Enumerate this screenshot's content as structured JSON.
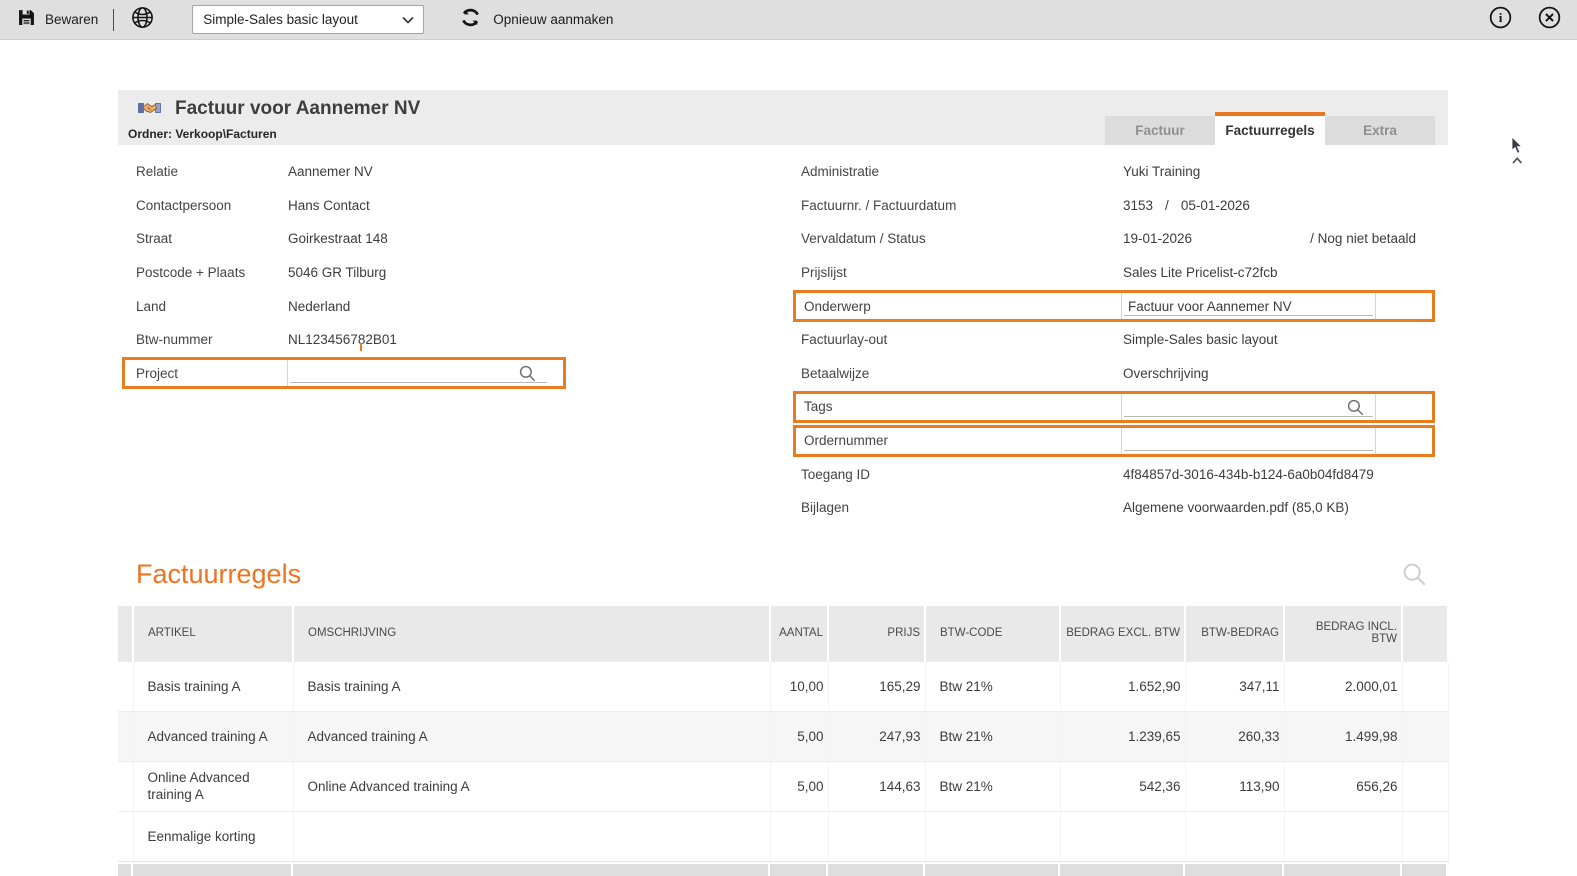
{
  "colors": {
    "accent_orange": "#e87c1e",
    "tab_indicator": "#e87722",
    "section_title": "#ee7420",
    "toolbar_bg": "#dfdfdf"
  },
  "toolbar": {
    "save_label": "Bewaren",
    "layout_select_value": "Simple-Sales basic layout",
    "recreate_label": "Opnieuw aanmaken"
  },
  "header": {
    "title": "Factuur voor Aannemer NV",
    "folder": "Ordner: Verkoop\\Facturen",
    "tabs": [
      {
        "label": "Factuur",
        "active": false
      },
      {
        "label": "Factuurregels",
        "active": true
      },
      {
        "label": "Extra",
        "active": false
      }
    ]
  },
  "details_left": {
    "rows": [
      {
        "label": "Relatie",
        "value": "Aannemer NV"
      },
      {
        "label": "Contactpersoon",
        "value": "Hans Contact"
      },
      {
        "label": "Straat",
        "value": "Goirkestraat 148"
      },
      {
        "label": "Postcode + Plaats",
        "value": "5046 GR Tilburg"
      },
      {
        "label": "Land",
        "value": "Nederland"
      },
      {
        "label": "Btw-nummer",
        "value": "NL123456782B01"
      }
    ],
    "project": {
      "label": "Project",
      "value": ""
    }
  },
  "details_right": {
    "administratie": {
      "label": "Administratie",
      "value": "Yuki Training"
    },
    "factuurnr": {
      "label": "Factuurnr.  /  Factuurdatum",
      "number": "3153",
      "separator": "/",
      "date": "05-01-2026"
    },
    "vervaldatum": {
      "label": "Vervaldatum  /  Status",
      "date": "19-01-2026",
      "status": "/  Nog niet betaald"
    },
    "prijslijst": {
      "label": "Prijslijst",
      "value": "Sales Lite Pricelist-c72fcb"
    },
    "onderwerp": {
      "label": "Onderwerp",
      "value": "Factuur voor Aannemer NV"
    },
    "factuurlayout": {
      "label": "Factuurlay-out",
      "value": "Simple-Sales basic layout"
    },
    "betaalwijze": {
      "label": "Betaalwijze",
      "value": "Overschrijving"
    },
    "tags": {
      "label": "Tags",
      "value": ""
    },
    "ordernummer": {
      "label": "Ordernummer",
      "value": ""
    },
    "toegang_id": {
      "label": "Toegang ID",
      "value": "4f84857d-3016-434b-b124-6a0b04fd8479"
    },
    "bijlagen": {
      "label": "Bijlagen",
      "value": "Algemene voorwaarden.pdf (85,0 KB)"
    }
  },
  "lines": {
    "title": "Factuurregels",
    "table": {
      "headers": [
        "ARTIKEL",
        "OMSCHRIJVING",
        "AANTAL",
        "PRIJS",
        "BTW-CODE",
        "BEDRAG EXCL. BTW",
        "BTW-BEDRAG",
        "BEDRAG INCL. BTW"
      ],
      "rows": [
        {
          "artikel": "Basis training A",
          "omschrijving": "Basis training A",
          "aantal": "10,00",
          "prijs": "165,29",
          "btw_code": "Btw 21%",
          "bedrag_excl": "1.652,90",
          "btw_bedrag": "347,11",
          "bedrag_incl": "2.000,01"
        },
        {
          "artikel": "Advanced training A",
          "omschrijving": "Advanced training A",
          "aantal": "5,00",
          "prijs": "247,93",
          "btw_code": "Btw 21%",
          "bedrag_excl": "1.239,65",
          "btw_bedrag": "260,33",
          "bedrag_incl": "1.499,98"
        },
        {
          "artikel": "Online Advanced training A",
          "omschrijving": "Online Advanced training A",
          "aantal": "5,00",
          "prijs": "144,63",
          "btw_code": "Btw 21%",
          "bedrag_excl": "542,36",
          "btw_bedrag": "113,90",
          "bedrag_incl": "656,26"
        },
        {
          "artikel": "Eenmalige korting",
          "omschrijving": "",
          "aantal": "",
          "prijs": "",
          "btw_code": "",
          "bedrag_excl": "",
          "btw_bedrag": "",
          "bedrag_incl": ""
        }
      ]
    }
  }
}
